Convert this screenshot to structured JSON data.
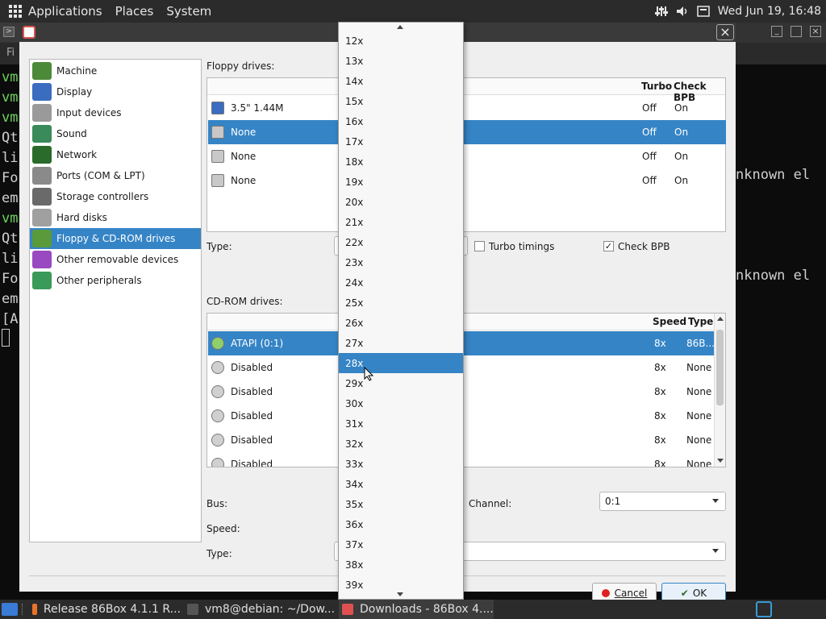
{
  "top_panel": {
    "menus": [
      "Applications",
      "Places",
      "System"
    ],
    "clock": "Wed Jun 19, 16:48",
    "tray_icons": [
      "sliders-icon",
      "speaker-icon",
      "keyboard-icon"
    ]
  },
  "terminal": {
    "lines": [
      "vm",
      "vm",
      "vm",
      "Qt",
      "li",
      "Fo",
      "em",
      "vm",
      "Qt",
      "li",
      "Fo",
      "em",
      "[A"
    ],
    "tab_text": "Fi",
    "right_text_1": "nknown el",
    "right_text_2": "nknown el"
  },
  "dialog": {
    "categories": [
      {
        "label": "Machine",
        "icon": "motherboard-icon"
      },
      {
        "label": "Display",
        "icon": "display-icon"
      },
      {
        "label": "Input devices",
        "icon": "keyboard-mouse-icon"
      },
      {
        "label": "Sound",
        "icon": "speaker-icon"
      },
      {
        "label": "Network",
        "icon": "network-icon"
      },
      {
        "label": "Ports (COM & LPT)",
        "icon": "port-icon"
      },
      {
        "label": "Storage controllers",
        "icon": "storage-icon"
      },
      {
        "label": "Hard disks",
        "icon": "hard-disk-icon"
      },
      {
        "label": "Floppy & CD-ROM drives",
        "icon": "cdrom-icon"
      },
      {
        "label": "Other removable devices",
        "icon": "removable-icon"
      },
      {
        "label": "Other peripherals",
        "icon": "chip-icon"
      }
    ],
    "selected_category": "Floppy & CD-ROM drives",
    "floppy": {
      "section_label": "Floppy drives:",
      "columns": [
        "Turbo",
        "Check BPB"
      ],
      "rows": [
        {
          "name": "3.5\" 1.44M",
          "turbo": "Off",
          "check_bpb": "On",
          "selected": false
        },
        {
          "name": "None",
          "turbo": "Off",
          "check_bpb": "On",
          "selected": true
        },
        {
          "name": "None",
          "turbo": "Off",
          "check_bpb": "On",
          "selected": false
        },
        {
          "name": "None",
          "turbo": "Off",
          "check_bpb": "On",
          "selected": false
        }
      ],
      "type_label": "Type:",
      "turbo_timings_label": "Turbo timings",
      "turbo_timings_checked": false,
      "check_bpb_label": "Check BPB",
      "check_bpb_checked": true
    },
    "cdrom": {
      "section_label": "CD-ROM drives:",
      "columns": [
        "Speed",
        "Type"
      ],
      "rows": [
        {
          "name": "ATAPI (0:1)",
          "speed": "8x",
          "type": "86B...",
          "selected": true
        },
        {
          "name": "Disabled",
          "speed": "8x",
          "type": "None",
          "selected": false
        },
        {
          "name": "Disabled",
          "speed": "8x",
          "type": "None",
          "selected": false
        },
        {
          "name": "Disabled",
          "speed": "8x",
          "type": "None",
          "selected": false
        },
        {
          "name": "Disabled",
          "speed": "8x",
          "type": "None",
          "selected": false
        },
        {
          "name": "Disabled",
          "speed": "8x",
          "type": "None",
          "selected": false
        }
      ],
      "bus_label": "Bus:",
      "channel_label": "Channel:",
      "channel_value": "0:1",
      "speed_label": "Speed:",
      "type_label": "Type:"
    },
    "buttons": {
      "cancel": "Cancel",
      "ok": "OK"
    },
    "colors": {
      "selection": "#3584c6",
      "cancel_dot": "#e02020"
    }
  },
  "speed_dropdown": {
    "options": [
      "12x",
      "13x",
      "14x",
      "15x",
      "16x",
      "17x",
      "18x",
      "19x",
      "20x",
      "21x",
      "22x",
      "23x",
      "24x",
      "25x",
      "26x",
      "27x",
      "28x",
      "29x",
      "30x",
      "31x",
      "32x",
      "33x",
      "34x",
      "35x",
      "36x",
      "37x",
      "38x",
      "39x"
    ],
    "highlighted": "28x"
  },
  "taskbar": {
    "tasks": [
      {
        "label": "Release 86Box 4.1.1 R...",
        "icon": "firefox-icon",
        "active": false
      },
      {
        "label": "vm8@debian: ~/Dow...",
        "icon": "terminal-icon",
        "active": false
      },
      {
        "label": "Downloads - 86Box 4....",
        "icon": "86box-icon",
        "active": true
      }
    ]
  }
}
